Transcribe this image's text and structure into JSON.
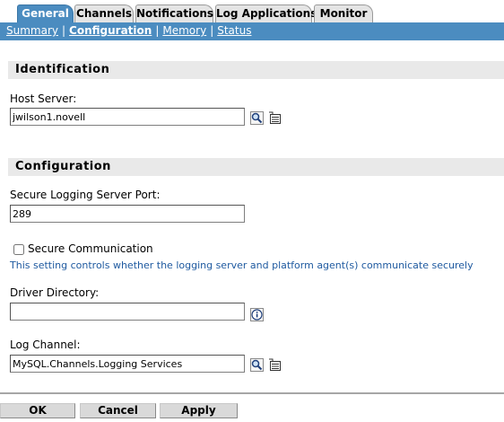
{
  "tabs": [
    {
      "label": "General",
      "active": true
    },
    {
      "label": "Channels",
      "active": false
    },
    {
      "label": "Notifications",
      "active": false
    },
    {
      "label": "Log Applications",
      "active": false
    },
    {
      "label": "Monitor",
      "active": false
    }
  ],
  "subnav": {
    "items": [
      "Summary",
      "Configuration",
      "Memory",
      "Status"
    ],
    "current": "Configuration",
    "separator": "|"
  },
  "identification": {
    "header": "Identification",
    "host_server_label": "Host Server:",
    "host_server_value": "jwilson1.novell"
  },
  "configuration": {
    "header": "Configuration",
    "port_label": "Secure Logging Server Port:",
    "port_value": "289",
    "secure_comm_label": "Secure Communication",
    "secure_comm_checked": false,
    "secure_comm_help": "This setting controls whether the logging server and platform agent(s) communicate securely",
    "driver_dir_label": "Driver Directory:",
    "driver_dir_value": "",
    "log_channel_label": "Log Channel:",
    "log_channel_value": "MySQL.Channels.Logging Services"
  },
  "buttons": {
    "ok": "OK",
    "cancel": "Cancel",
    "apply": "Apply"
  },
  "icons": {
    "browse": "magnifier-browse-icon",
    "history": "object-history-icon",
    "info": "info-icon"
  },
  "colors": {
    "accent": "#4b8cc0",
    "section_bg": "#e9e9e9",
    "help_text": "#1f5aa0"
  }
}
